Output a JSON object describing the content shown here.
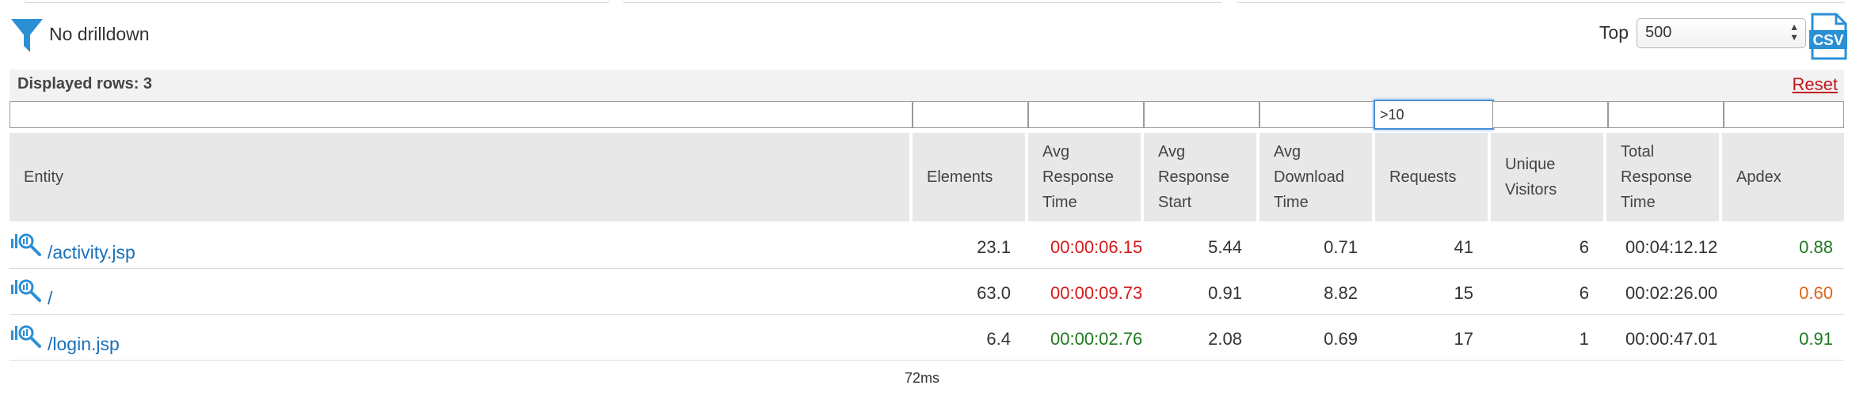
{
  "toolbar": {
    "drilldown_label": "No drilldown",
    "top_label": "Top",
    "top_value": "500",
    "csv_label": "CSV"
  },
  "summary": {
    "displayed_rows": "Displayed rows: 3",
    "reset_label": "Reset"
  },
  "filters": {
    "requests": ">10"
  },
  "columns": [
    "Entity",
    "Elements",
    "Avg Response Time",
    "Avg Response Start",
    "Avg Download Time",
    "Requests",
    "Unique Visitors",
    "Total Response Time",
    "Apdex"
  ],
  "rows": [
    {
      "entity": "/activity.jsp",
      "elements": "23.1",
      "avg_response_time": "00:00:06.15",
      "avg_response_start": "5.44",
      "avg_download_time": "0.71",
      "requests": "41",
      "unique_visitors": "6",
      "total_response_time": "00:04:12.12",
      "apdex": "0.88"
    },
    {
      "entity": "/",
      "elements": "63.0",
      "avg_response_time": "00:00:09.73",
      "avg_response_start": "0.91",
      "avg_download_time": "8.82",
      "requests": "15",
      "unique_visitors": "6",
      "total_response_time": "00:02:26.00",
      "apdex": "0.60"
    },
    {
      "entity": "/login.jsp",
      "elements": "6.4",
      "avg_response_time": "00:00:02.76",
      "avg_response_start": "2.08",
      "avg_download_time": "0.69",
      "requests": "17",
      "unique_visitors": "1",
      "total_response_time": "00:00:47.01",
      "apdex": "0.91"
    }
  ],
  "footer": {
    "timing": "72ms"
  },
  "colors": {
    "link": "#1a6fba",
    "bad": "#d61a1a",
    "good": "#1e7a1e",
    "fair": "#e0661a",
    "accent": "#2b8fd6"
  }
}
